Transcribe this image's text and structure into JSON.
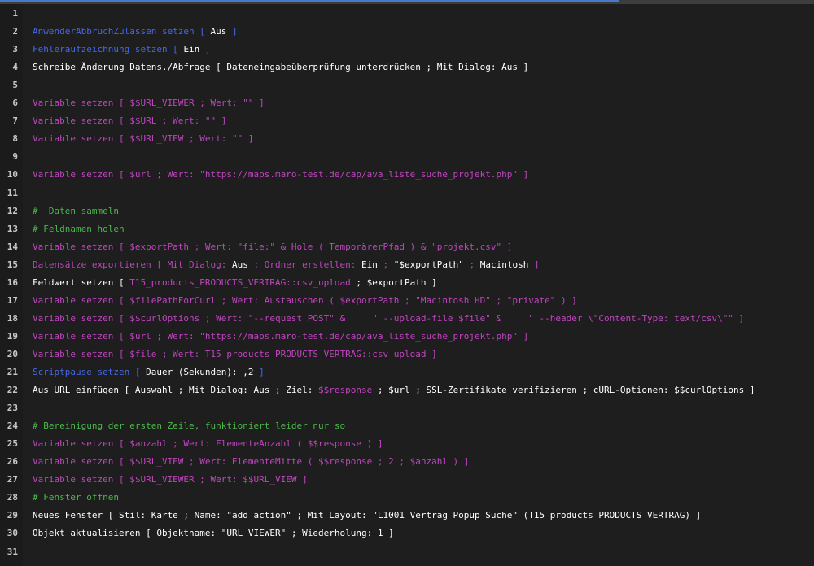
{
  "colors": {
    "background": "#1e1e1e",
    "script_step": "#c045c0",
    "control_step": "#4468e8",
    "default_text": "#ffffff",
    "comment": "#4bb84b",
    "line_number": "#c8c8c8"
  },
  "lines": [
    {
      "num": "1",
      "segments": []
    },
    {
      "num": "2",
      "segments": [
        {
          "c": "blue",
          "t": "AnwenderAbbruchZulassen setzen [ "
        },
        {
          "c": "white",
          "t": "Aus"
        },
        {
          "c": "blue",
          "t": " ]"
        }
      ]
    },
    {
      "num": "3",
      "segments": [
        {
          "c": "blue",
          "t": "Fehleraufzeichnung setzen [ "
        },
        {
          "c": "white",
          "t": "Ein"
        },
        {
          "c": "blue",
          "t": " ]"
        }
      ]
    },
    {
      "num": "4",
      "segments": [
        {
          "c": "white",
          "t": "Schreibe Änderung Datens./Abfrage [ Dateneingabeüberprüfung unterdrücken ; Mit Dialog: Aus ]"
        }
      ]
    },
    {
      "num": "5",
      "segments": []
    },
    {
      "num": "6",
      "segments": [
        {
          "c": "step",
          "t": "Variable setzen [ $$URL_VIEWER ; Wert: \"\" ]"
        }
      ]
    },
    {
      "num": "7",
      "segments": [
        {
          "c": "step",
          "t": "Variable setzen [ $$URL ; Wert: \"\" ]"
        }
      ]
    },
    {
      "num": "8",
      "segments": [
        {
          "c": "step",
          "t": "Variable setzen [ $$URL_VIEW ; Wert: \"\" ]"
        }
      ]
    },
    {
      "num": "9",
      "segments": []
    },
    {
      "num": "10",
      "segments": [
        {
          "c": "step",
          "t": "Variable setzen [ $url ; Wert: \"https://maps.maro-test.de/cap/ava_liste_suche_projekt.php\" ]"
        }
      ]
    },
    {
      "num": "11",
      "segments": []
    },
    {
      "num": "12",
      "segments": [
        {
          "c": "green",
          "t": "#  Daten sammeln"
        }
      ]
    },
    {
      "num": "13",
      "segments": [
        {
          "c": "green",
          "t": "# Feldnamen holen"
        }
      ]
    },
    {
      "num": "14",
      "segments": [
        {
          "c": "step",
          "t": "Variable setzen [ $exportPath ; Wert: \"file:\" & Hole ( TemporärerPfad ) & \"projekt.csv\" ]"
        }
      ]
    },
    {
      "num": "15",
      "segments": [
        {
          "c": "step",
          "t": "Datensätze exportieren [ Mit Dialog: "
        },
        {
          "c": "white",
          "t": "Aus"
        },
        {
          "c": "step",
          "t": " ; Ordner erstellen: "
        },
        {
          "c": "white",
          "t": "Ein"
        },
        {
          "c": "step",
          "t": " ; "
        },
        {
          "c": "white",
          "t": "\"$exportPath\""
        },
        {
          "c": "step",
          "t": " ; "
        },
        {
          "c": "white",
          "t": "Macintosh"
        },
        {
          "c": "step",
          "t": " ]"
        }
      ]
    },
    {
      "num": "16",
      "segments": [
        {
          "c": "white",
          "t": "Feldwert setzen [ "
        },
        {
          "c": "step",
          "t": "T15_products_PRODUCTS_VERTRAG::csv_upload"
        },
        {
          "c": "white",
          "t": " ; $exportPath ]"
        }
      ]
    },
    {
      "num": "17",
      "segments": [
        {
          "c": "step",
          "t": "Variable setzen [ $filePathForCurl ; Wert: Austauschen ( $exportPath ; \"Macintosh HD\" ; \"private\" ) ]"
        }
      ]
    },
    {
      "num": "18",
      "segments": [
        {
          "c": "step",
          "t": "Variable setzen [ $$curlOptions ; Wert: \"--request POST\" &     \" --upload-file $file\" &     \" --header \\\"Content-Type: text/csv\\\"\" ]"
        }
      ]
    },
    {
      "num": "19",
      "segments": [
        {
          "c": "step",
          "t": "Variable setzen [ $url ; Wert: \"https://maps.maro-test.de/cap/ava_liste_suche_projekt.php\" ]"
        }
      ]
    },
    {
      "num": "20",
      "segments": [
        {
          "c": "step",
          "t": "Variable setzen [ $file ; Wert: T15_products_PRODUCTS_VERTRAG::csv_upload ]"
        }
      ]
    },
    {
      "num": "21",
      "segments": [
        {
          "c": "blue",
          "t": "Scriptpause setzen [ "
        },
        {
          "c": "white",
          "t": "Dauer (Sekunden): ,2"
        },
        {
          "c": "blue",
          "t": " ]"
        }
      ]
    },
    {
      "num": "22",
      "segments": [
        {
          "c": "white",
          "t": "Aus URL einfügen [ Auswahl ; Mit Dialog: Aus ; Ziel: "
        },
        {
          "c": "step",
          "t": "$$response"
        },
        {
          "c": "white",
          "t": " ; $url ; SSL-Zertifikate verifizieren ; cURL-Optionen: $$curlOptions ]"
        }
      ]
    },
    {
      "num": "23",
      "segments": []
    },
    {
      "num": "24",
      "segments": [
        {
          "c": "green",
          "t": "# Bereinigung der ersten Zeile, funktioniert leider nur so"
        }
      ]
    },
    {
      "num": "25",
      "segments": [
        {
          "c": "step",
          "t": "Variable setzen [ $anzahl ; Wert: ElementeAnzahl ( $$response ) ]"
        }
      ]
    },
    {
      "num": "26",
      "segments": [
        {
          "c": "step",
          "t": "Variable setzen [ $$URL_VIEW ; Wert: ElementeMitte ( $$response ; 2 ; $anzahl ) ]"
        }
      ]
    },
    {
      "num": "27",
      "segments": [
        {
          "c": "step",
          "t": "Variable setzen [ $$URL_VIEWER ; Wert: $$URL_VIEW ]"
        }
      ]
    },
    {
      "num": "28",
      "segments": [
        {
          "c": "green",
          "t": "# Fenster öffnen"
        }
      ]
    },
    {
      "num": "29",
      "segments": [
        {
          "c": "white",
          "t": "Neues Fenster [ Stil: Karte ; Name: \"add_action\" ; Mit Layout: \"L1001_Vertrag_Popup_Suche\" (T15_products_PRODUCTS_VERTRAG) ]"
        }
      ]
    },
    {
      "num": "30",
      "segments": [
        {
          "c": "white",
          "t": "Objekt aktualisieren [ Objektname: \"URL_VIEWER\" ; Wiederholung: 1 ]"
        }
      ]
    },
    {
      "num": "31",
      "segments": []
    }
  ]
}
